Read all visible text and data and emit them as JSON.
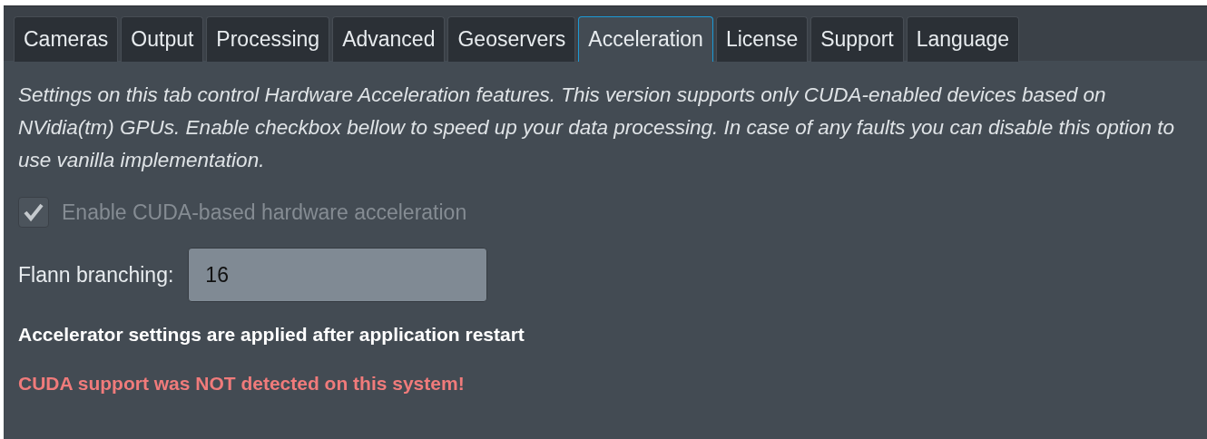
{
  "tabs": [
    {
      "label": "Cameras",
      "selected": false
    },
    {
      "label": "Output",
      "selected": false
    },
    {
      "label": "Processing",
      "selected": false
    },
    {
      "label": "Advanced",
      "selected": false
    },
    {
      "label": "Geoservers",
      "selected": false
    },
    {
      "label": "Acceleration",
      "selected": true
    },
    {
      "label": "License",
      "selected": false
    },
    {
      "label": "Support",
      "selected": false
    },
    {
      "label": "Language",
      "selected": false
    }
  ],
  "description": "Settings on this tab control Hardware Acceleration features. This version supports only CUDA-enabled devices based on NVidia(tm) GPUs. Enable checkbox bellow to speed up your data processing. In case of any faults you can disable this option to use vanilla implementation.",
  "checkbox": {
    "label": "Enable CUDA-based hardware acceleration",
    "checked": true,
    "disabled": true
  },
  "field": {
    "label": "Flann branching:",
    "value": "16"
  },
  "messages": [
    {
      "kind": "note",
      "text": "Accelerator settings are applied after application restart"
    },
    {
      "kind": "error",
      "text": "CUDA support was NOT detected on this system!"
    }
  ]
}
